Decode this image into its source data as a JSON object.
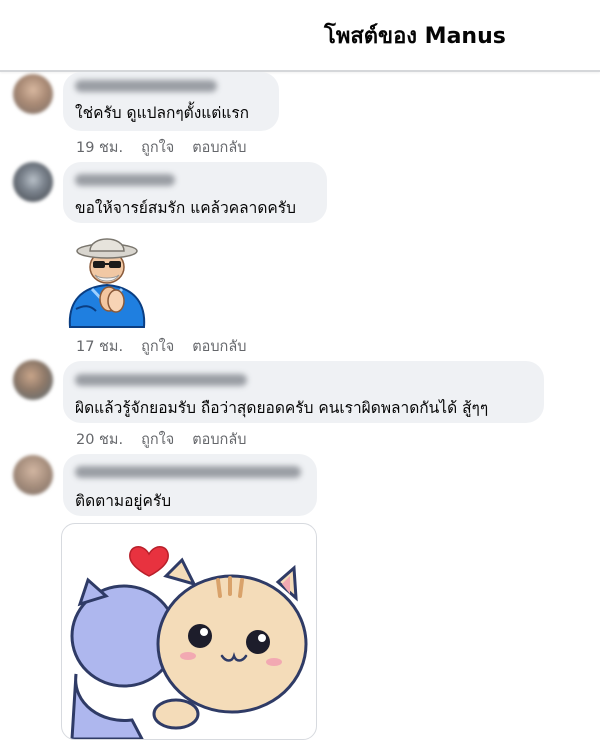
{
  "header": {
    "title": "โพสต์ของ Manus"
  },
  "comments": [
    {
      "text": "ใช่ครับ ดูแปลกๆตั้งแต่แรก",
      "time": "19 ชม.",
      "like": "ถูกใจ",
      "reply": "ตอบกลับ"
    },
    {
      "text": "ขอให้จารย์สมรัก แคล้วคลาดครับ",
      "time": "17 ชม.",
      "like": "ถูกใจ",
      "reply": "ตอบกลับ"
    },
    {
      "text": "ผิดแล้วรู้จักยอมรับ ถือว่าสุดยอดครับ คนเราผิดพลาดกันได้ สู้ๆๆ",
      "time": "20 ชม.",
      "like": "ถูกใจ",
      "reply": "ตอบกลับ"
    },
    {
      "text": "ติดตามอยู่ครับ"
    }
  ],
  "colors": {
    "bubble": "#eff1f4",
    "meta_text": "#65676b",
    "divider": "#d5d7da"
  },
  "icons": {
    "sticker_1": "grandpa-clapping-sticker",
    "sticker_2": "cat-hug-heart-sticker"
  }
}
